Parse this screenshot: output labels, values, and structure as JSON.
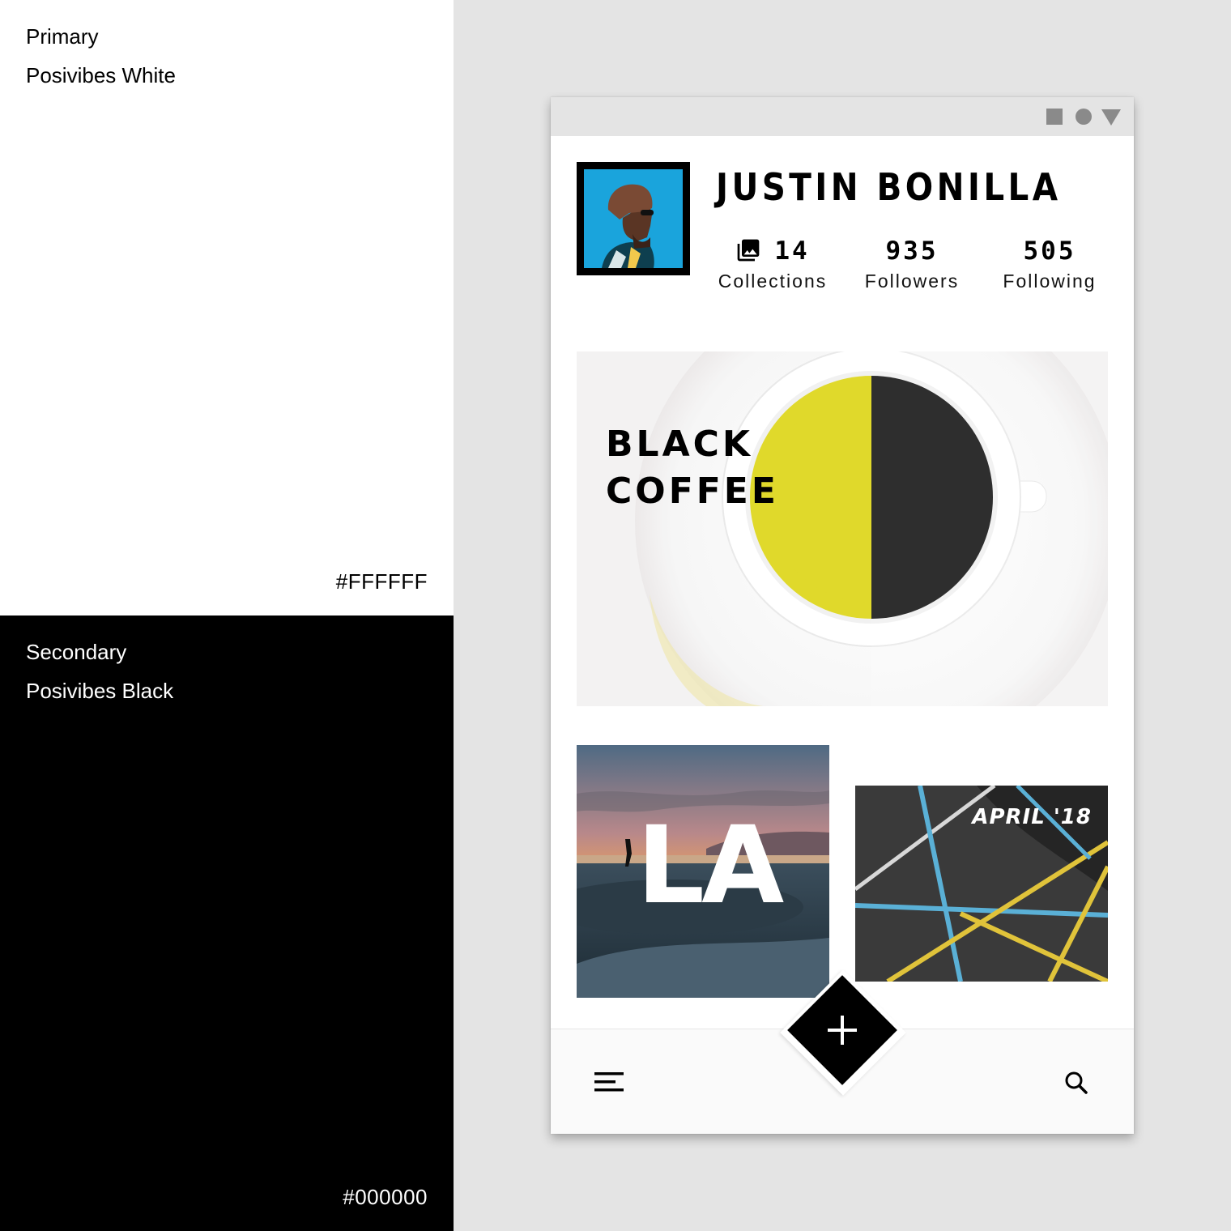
{
  "palette": {
    "primary": {
      "role": "Primary",
      "name": "Posivibes White",
      "hex": "#FFFFFF"
    },
    "secondary": {
      "role": "Secondary",
      "name": "Posivibes Black",
      "hex": "#000000"
    }
  },
  "profile": {
    "name": "JUSTIN BONILLA",
    "stats": [
      {
        "value": "14",
        "label": "Collections",
        "icon": "collections-icon"
      },
      {
        "value": "935",
        "label": "Followers"
      },
      {
        "value": "505",
        "label": "Following"
      }
    ]
  },
  "cards": {
    "coffee": {
      "title_line1": "BLACK",
      "title_line2": "COFFEE"
    },
    "la": {
      "title": "LA"
    },
    "april": {
      "title": "APRIL '18"
    }
  },
  "nav": {
    "menu_icon": "menu-icon",
    "add_icon": "plus-icon",
    "search_icon": "search-icon"
  },
  "colors": {
    "accent_yellow": "#DED61A",
    "avatar_blue": "#1AA4DC"
  }
}
